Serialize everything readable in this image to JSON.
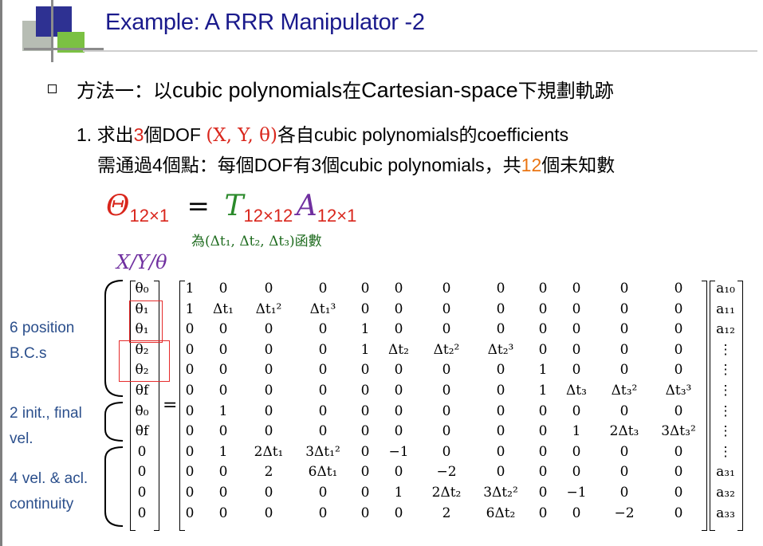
{
  "title": "Example: A RRR Manipulator -2",
  "bullet": {
    "prefix": "方法一：以",
    "mid1": "cubic polynomials",
    "mid2": "在",
    "mid3": "Cartesian-space",
    "suffix": "下規劃軌跡"
  },
  "step1": {
    "num": "1.",
    "a": "求出",
    "count": "3",
    "b": "個DOF",
    "dof": "(X, Y, θ)",
    "c": "各自",
    "d": "cubic polynomials",
    "e": "的",
    "f": "coefficients"
  },
  "step2": {
    "a": "需通過4個點：每個DOF有3個cubic polynomials，共",
    "count": "12",
    "b": "個未知數"
  },
  "equation": {
    "lhs": "Θ",
    "lhs_sub": "12×1",
    "eq": "=",
    "T": "T",
    "T_sub": "12×12",
    "A": "A",
    "A_sub": "12×1",
    "note": "為(Δt₁, Δt₂, Δt₃)函數",
    "xyt": "X/Y/θ"
  },
  "groups": {
    "position": [
      "6 position",
      "B.C.s"
    ],
    "velocity": [
      "2 init., final",
      "vel."
    ],
    "continuity": [
      "4 vel. & acl.",
      "continuity"
    ]
  },
  "lhs_vector": [
    "θ₀",
    "θ₁",
    "θ₁",
    "θ₂",
    "θ₂",
    "θf",
    "θ̇₀",
    "θ̇f",
    "0",
    "0",
    "0",
    "0"
  ],
  "T_matrix": [
    [
      "1",
      "0",
      "0",
      "0",
      "0",
      "0",
      "0",
      "0",
      "0",
      "0",
      "0",
      "0"
    ],
    [
      "1",
      "Δt₁",
      "Δt₁²",
      "Δt₁³",
      "0",
      "0",
      "0",
      "0",
      "0",
      "0",
      "0",
      "0"
    ],
    [
      "0",
      "0",
      "0",
      "0",
      "1",
      "0",
      "0",
      "0",
      "0",
      "0",
      "0",
      "0"
    ],
    [
      "0",
      "0",
      "0",
      "0",
      "1",
      "Δt₂",
      "Δt₂²",
      "Δt₂³",
      "0",
      "0",
      "0",
      "0"
    ],
    [
      "0",
      "0",
      "0",
      "0",
      "0",
      "0",
      "0",
      "0",
      "1",
      "0",
      "0",
      "0"
    ],
    [
      "0",
      "0",
      "0",
      "0",
      "0",
      "0",
      "0",
      "0",
      "1",
      "Δt₃",
      "Δt₃²",
      "Δt₃³"
    ],
    [
      "0",
      "1",
      "0",
      "0",
      "0",
      "0",
      "0",
      "0",
      "0",
      "0",
      "0",
      "0"
    ],
    [
      "0",
      "0",
      "0",
      "0",
      "0",
      "0",
      "0",
      "0",
      "0",
      "1",
      "2Δt₃",
      "3Δt₃²"
    ],
    [
      "0",
      "1",
      "2Δt₁",
      "3Δt₁²",
      "0",
      "−1",
      "0",
      "0",
      "0",
      "0",
      "0",
      "0"
    ],
    [
      "0",
      "0",
      "2",
      "6Δt₁",
      "0",
      "0",
      "−2",
      "0",
      "0",
      "0",
      "0",
      "0"
    ],
    [
      "0",
      "0",
      "0",
      "0",
      "0",
      "1",
      "2Δt₂",
      "3Δt₂²",
      "0",
      "−1",
      "0",
      "0"
    ],
    [
      "0",
      "0",
      "0",
      "0",
      "0",
      "0",
      "2",
      "6Δt₂",
      "0",
      "0",
      "−2",
      "0"
    ]
  ],
  "rhs_vector": [
    "a₁₀",
    "a₁₁",
    "a₁₂",
    "⋮",
    "⋮",
    "⋮",
    "⋮",
    "⋮",
    "⋮",
    "a₃₁",
    "a₃₂",
    "a₃₃"
  ],
  "eq_sign": "=",
  "colors": {
    "title": "#1a1a8c",
    "highlight_red": "#d9261c",
    "highlight_orange": "#ea7513",
    "T_color": "#2b8a2b",
    "A_color": "#7030a0",
    "label_color": "#2b4f8c",
    "box_red": "#e52b2b"
  }
}
